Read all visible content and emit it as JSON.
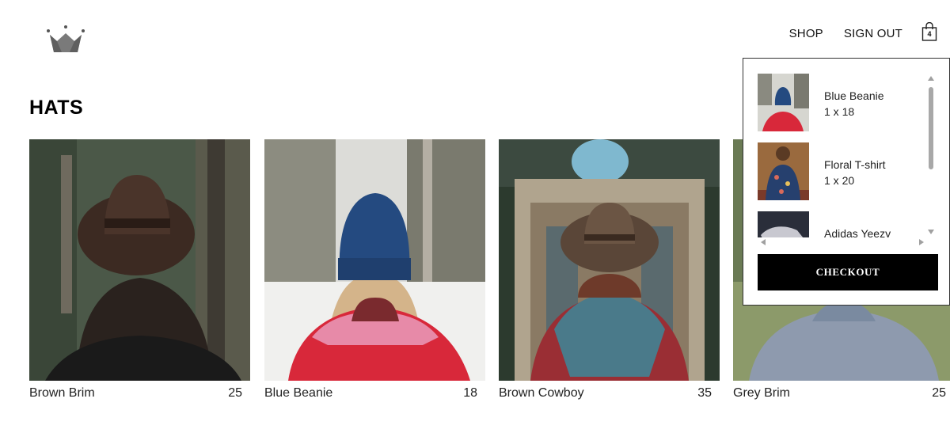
{
  "header": {
    "logo_icon": "crown-icon",
    "nav": {
      "shop": "SHOP",
      "sign_out": "SIGN OUT"
    },
    "cart_icon": "shopping-bag-icon",
    "cart_count": "4"
  },
  "page": {
    "title": "HATS"
  },
  "products": [
    {
      "name": "Brown Brim",
      "price": "25"
    },
    {
      "name": "Blue Beanie",
      "price": "18"
    },
    {
      "name": "Brown Cowboy",
      "price": "35"
    },
    {
      "name": "Grey Brim",
      "price": "25"
    }
  ],
  "cart_dropdown": {
    "items": [
      {
        "name": "Blue Beanie",
        "qty_price": "1 x 18"
      },
      {
        "name": "Floral T-shirt",
        "qty_price": "1 x 20"
      },
      {
        "name": "Adidas Yeezy",
        "qty_price": ""
      }
    ],
    "checkout_label": "CHECKOUT"
  },
  "colors": {
    "accent": "#000000",
    "text": "#222222",
    "border": "#333333"
  }
}
